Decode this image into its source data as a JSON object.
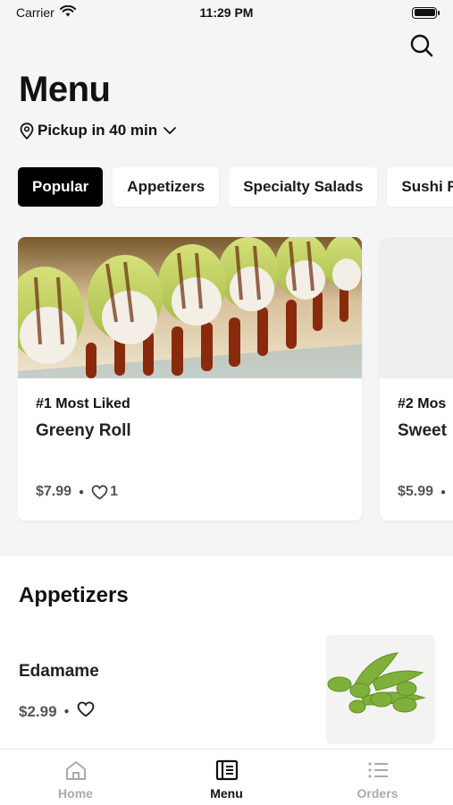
{
  "status": {
    "carrier": "Carrier",
    "time": "11:29 PM"
  },
  "header": {
    "title": "Menu",
    "pickup": "Pickup in 40 min"
  },
  "categories": [
    {
      "label": "Popular",
      "active": true
    },
    {
      "label": "Appetizers",
      "active": false
    },
    {
      "label": "Specialty Salads",
      "active": false
    },
    {
      "label": "Sushi R",
      "active": false
    }
  ],
  "popular": [
    {
      "rank": "#1 Most Liked",
      "name": "Greeny Roll",
      "price": "$7.99",
      "likes": "1"
    },
    {
      "rank": "#2 Mos",
      "name": "Sweet",
      "price": "$5.99"
    }
  ],
  "appetizers": {
    "title": "Appetizers",
    "items": [
      {
        "name": "Edamame",
        "price": "$2.99"
      }
    ]
  },
  "tabbar": [
    {
      "label": "Home",
      "icon": "home-icon"
    },
    {
      "label": "Menu",
      "icon": "menu-icon",
      "active": true
    },
    {
      "label": "Orders",
      "icon": "orders-icon"
    }
  ]
}
